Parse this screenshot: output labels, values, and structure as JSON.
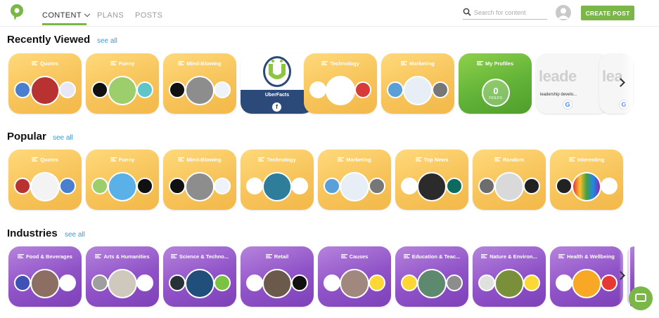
{
  "nav": {
    "content_label": "CONTENT",
    "plans_label": "PLANS",
    "posts_label": "POSTS"
  },
  "search": {
    "placeholder": "Search for content"
  },
  "actions": {
    "create_post_label": "CREATE POST"
  },
  "colors": {
    "brand_green": "#7ab648",
    "card_yellow": "#f7c45b",
    "card_purple": "#8f52c7",
    "card_green": "#62b338",
    "link_blue": "#3a9ad9"
  },
  "sections": {
    "recent": {
      "title": "Recently Viewed",
      "see_all": "see all",
      "cards": [
        {
          "label": "Quotes",
          "style": "yellow"
        },
        {
          "label": "Funny",
          "style": "yellow"
        },
        {
          "label": "Mind-Blowing",
          "style": "yellow"
        },
        {
          "label": "UberFacts",
          "style": "uber"
        },
        {
          "label": "Technology",
          "style": "yellow"
        },
        {
          "label": "Marketing",
          "style": "yellow"
        },
        {
          "label": "My Profiles",
          "style": "green",
          "count": "0",
          "count_label": "FEEDS"
        },
        {
          "label": "leadership develo...",
          "style": "lead",
          "big": "leade"
        },
        {
          "label": "",
          "style": "lead",
          "big": "lea"
        }
      ]
    },
    "popular": {
      "title": "Popular",
      "see_all": "see all",
      "cards": [
        {
          "label": "Quotes"
        },
        {
          "label": "Funny"
        },
        {
          "label": "Mind-Blowing"
        },
        {
          "label": "Technology"
        },
        {
          "label": "Marketing"
        },
        {
          "label": "Top News"
        },
        {
          "label": "Random"
        },
        {
          "label": "Interesting"
        }
      ]
    },
    "industries": {
      "title": "Industries",
      "see_all": "see all",
      "cards": [
        {
          "label": "Food & Beverages"
        },
        {
          "label": "Arts & Humanities"
        },
        {
          "label": "Science & Techno..."
        },
        {
          "label": "Retail"
        },
        {
          "label": "Causes"
        },
        {
          "label": "Education & Teac..."
        },
        {
          "label": "Nature & Environ..."
        },
        {
          "label": "Health & Wellbeing"
        }
      ]
    }
  }
}
